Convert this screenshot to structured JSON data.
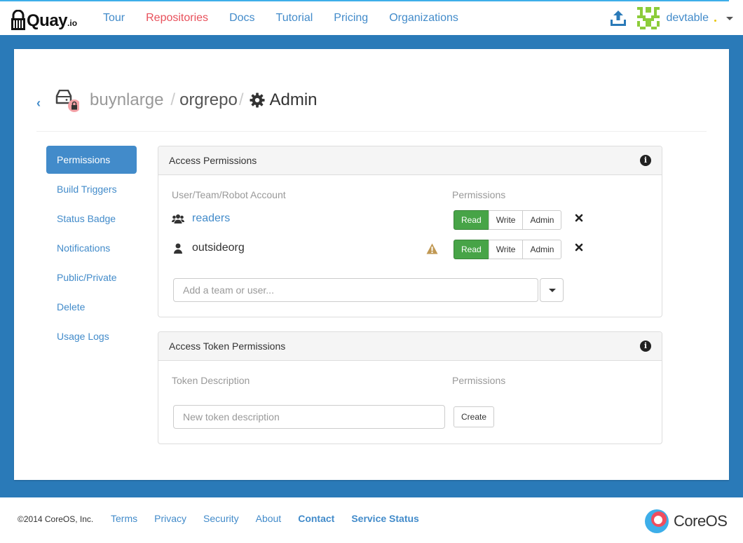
{
  "nav": {
    "logo_text": "Quay",
    "logo_suffix": ".io",
    "links": [
      "Tour",
      "Repositories",
      "Docs",
      "Tutorial",
      "Pricing",
      "Organizations"
    ],
    "active": "Repositories",
    "username": "devtable"
  },
  "header": {
    "namespace": "buynlarge",
    "separator": "/",
    "repository": "orgrepo",
    "page_title": "Admin"
  },
  "sidebar": {
    "items": [
      {
        "label": "Permissions",
        "active": true
      },
      {
        "label": "Build Triggers"
      },
      {
        "label": "Status Badge"
      },
      {
        "label": "Notifications"
      },
      {
        "label": "Public/Private"
      },
      {
        "label": "Delete"
      },
      {
        "label": "Usage Logs"
      }
    ]
  },
  "access_permissions": {
    "title": "Access Permissions",
    "col_entity": "User/Team/Robot Account",
    "col_permissions": "Permissions",
    "rows": [
      {
        "name": "readers",
        "kind": "team",
        "permission": "Read"
      },
      {
        "name": "outsideorg",
        "kind": "user",
        "permission": "Read",
        "warning": true
      }
    ],
    "buttons": [
      "Read",
      "Write",
      "Admin"
    ],
    "add_placeholder": "Add a team or user..."
  },
  "token_permissions": {
    "title": "Access Token Permissions",
    "col_description": "Token Description",
    "col_permissions": "Permissions",
    "input_placeholder": "New token description",
    "create_label": "Create"
  },
  "footer": {
    "copyright": "©2014 CoreOS, Inc.",
    "links": [
      "Terms",
      "Privacy",
      "Security",
      "About",
      "Contact",
      "Service Status"
    ],
    "brand": "CoreOS"
  },
  "colors": {
    "brand_blue": "#2a7ab8",
    "link": "#428bca",
    "active_nav": "#e8505b",
    "read_green": "#47a447"
  }
}
